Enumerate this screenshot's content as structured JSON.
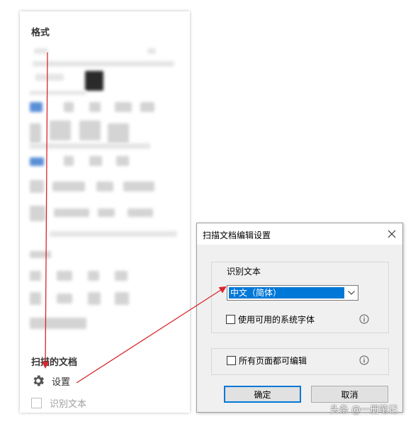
{
  "format_panel": {
    "title": "格式",
    "scanned_section_title": "扫描的文档",
    "settings_label": "设置",
    "ocr_label": "识别文本"
  },
  "dialog": {
    "title": "扫描文档编辑设置",
    "group_label": "识别文本",
    "language_value": "中文（简体）",
    "use_system_fonts_label": "使用可用的系统字体",
    "all_pages_editable_label": "所有页面都可编辑",
    "ok_label": "确定",
    "cancel_label": "取消"
  },
  "icons": {
    "settings": "gear-icon",
    "close": "close-icon",
    "dropdown": "chevron-down-icon",
    "info": "info-icon"
  },
  "colors": {
    "selection": "#0078d7",
    "annotation": "#d9262b"
  },
  "watermark": "头条 @一册笔记"
}
